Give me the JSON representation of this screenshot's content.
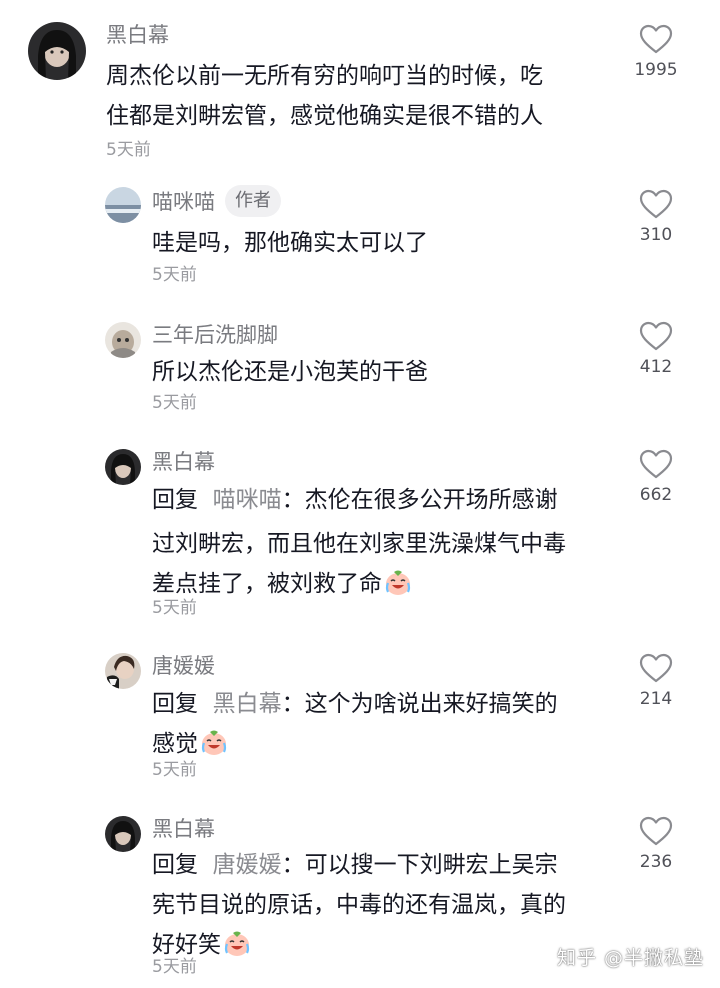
{
  "comments": [
    {
      "user": "黑白幕",
      "lines": [
        "周杰伦以前一无所有穷的响叮当的时候，吃",
        "住都是刘畊宏管，感觉他确实是很不错的人"
      ],
      "time": "5天前",
      "likes": "1995"
    },
    {
      "user": "喵咪喵",
      "badge": "作者",
      "lines": [
        "哇是吗，那他确实太可以了"
      ],
      "time": "5天前",
      "likes": "310"
    },
    {
      "user": "三年后洗脚脚",
      "lines": [
        "所以杰伦还是小泡芙的干爸"
      ],
      "time": "5天前",
      "likes": "412"
    },
    {
      "user": "黑白幕",
      "reply_prefix": "回复",
      "reply_to": "喵咪喵",
      "lines": [
        "：杰伦在很多公开场所感谢",
        "过刘畊宏，而且他在刘家里洗澡煤气中毒",
        "差点挂了，被刘救了命"
      ],
      "time": "5天前",
      "likes": "662"
    },
    {
      "user": "唐媛媛",
      "reply_prefix": "回复",
      "reply_to": "黑白幕",
      "lines": [
        "：这个为啥说出来好搞笑的",
        "感觉"
      ],
      "time": "5天前",
      "likes": "214"
    },
    {
      "user": "黑白幕",
      "reply_prefix": "回复",
      "reply_to": "唐媛媛",
      "lines": [
        "：可以搜一下刘畊宏上吴宗",
        "宪节目说的原话，中毒的还有温岚，真的",
        "好好笑"
      ],
      "time": "5天前",
      "likes": "236"
    }
  ],
  "watermark": "知乎 @半撇私塾",
  "icons": {
    "like": "heart-outline-icon",
    "emoji": "crying-laughing-emoji"
  },
  "colors": {
    "username": "#7a7b80",
    "text": "#161823",
    "time": "#9a9ba0",
    "heart": "#8a8b90"
  }
}
